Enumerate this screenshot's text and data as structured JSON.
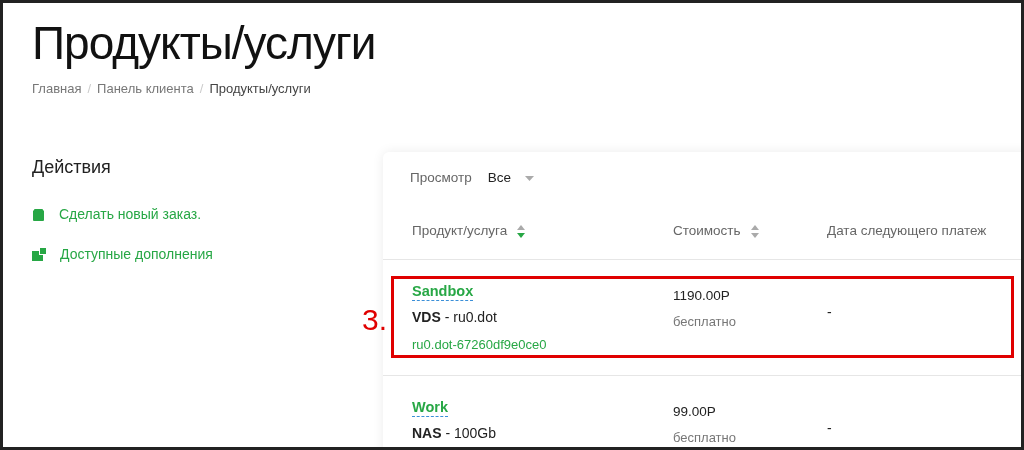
{
  "page_title": "Продукты/услуги",
  "breadcrumb": [
    {
      "label": "Главная",
      "current": false
    },
    {
      "label": "Панель клиента",
      "current": false
    },
    {
      "label": "Продукты/услуги",
      "current": true
    }
  ],
  "breadcrumb_separator": "/",
  "sidebar": {
    "title": "Действия",
    "items": [
      {
        "label": "Сделать новый заказ."
      },
      {
        "label": "Доступные дополнения"
      }
    ]
  },
  "filter": {
    "label": "Просмотр",
    "value": "Все"
  },
  "table": {
    "columns": [
      {
        "label": "Продукт/услуга",
        "sorted": true
      },
      {
        "label": "Стоимость",
        "sorted": false
      },
      {
        "label": "Дата следующего платеж"
      }
    ],
    "rows": [
      {
        "name": "Sandbox",
        "product": "**VDS** - ru0.dot",
        "domain": "ru0.dot-67260df9e0ce0",
        "price": "1190.00Р",
        "billing": "бесплатно",
        "next_due": "-"
      },
      {
        "name": "Work",
        "product": "**NAS** - 100Gb",
        "price": "99.00Р",
        "billing": "бесплатно",
        "next_due": "-"
      }
    ]
  },
  "annotation": {
    "label": "3."
  }
}
